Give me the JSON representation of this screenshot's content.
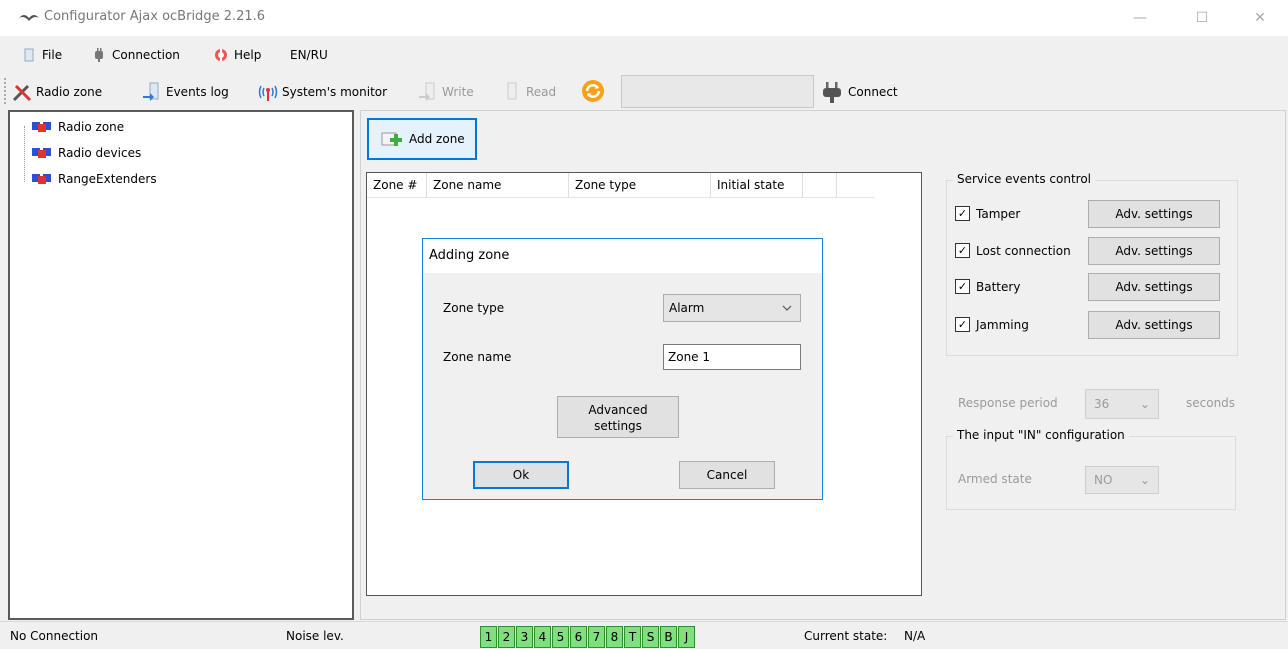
{
  "window": {
    "title": "Configurator Ajax ocBridge 2.21.6",
    "minimize": "—",
    "maximize": "☐",
    "close": "✕"
  },
  "menu": {
    "file": "File",
    "connection": "Connection",
    "help": "Help",
    "lang": "EN/RU"
  },
  "toolbar": {
    "radio_zone": "Radio zone",
    "events_log": "Events log",
    "systems_monitor": "System's monitor",
    "write": "Write",
    "read": "Read",
    "connect": "Connect"
  },
  "tree": {
    "items": [
      "Radio zone",
      "Radio devices",
      "RangeExtenders"
    ]
  },
  "main": {
    "add_zone": "Add zone",
    "table_headers": [
      "Zone #",
      "Zone name",
      "Zone type",
      "Initial state"
    ]
  },
  "service_events": {
    "title": "Service events control",
    "items": [
      {
        "label": "Tamper",
        "checked": true,
        "button": "Adv. settings"
      },
      {
        "label": "Lost connection",
        "checked": true,
        "button": "Adv. settings"
      },
      {
        "label": "Battery",
        "checked": true,
        "button": "Adv. settings"
      },
      {
        "label": "Jamming",
        "checked": true,
        "button": "Adv. settings"
      }
    ],
    "check_mark": "✓"
  },
  "response": {
    "label": "Response period",
    "value": "36",
    "unit": "seconds"
  },
  "input_config": {
    "title": "The input \"IN\" configuration",
    "armed_label": "Armed state",
    "armed_value": "NO"
  },
  "dialog": {
    "title": "Adding zone",
    "zone_type_label": "Zone type",
    "zone_type_value": "Alarm",
    "zone_name_label": "Zone name",
    "zone_name_value": "Zone 1",
    "advanced_line1": "Advanced",
    "advanced_line2": "settings",
    "ok": "Ok",
    "cancel": "Cancel"
  },
  "status": {
    "connection": "No Connection",
    "noise": "Noise lev.",
    "indicators": [
      "1",
      "2",
      "3",
      "4",
      "5",
      "6",
      "7",
      "8",
      "T",
      "S",
      "B",
      "J"
    ],
    "current_state_label": "Current state:",
    "current_state_value": "N/A"
  },
  "colors": {
    "accent": "#0078d7",
    "indicator_green": "#7ee07e"
  }
}
